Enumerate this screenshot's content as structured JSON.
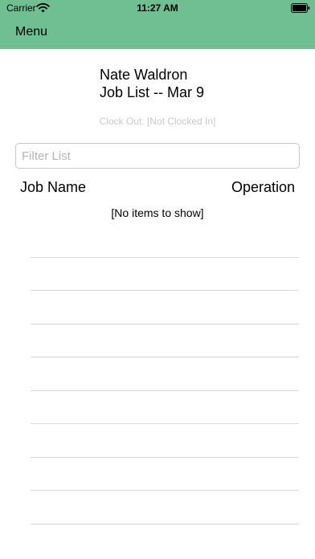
{
  "status_bar": {
    "carrier": "Carrier",
    "time": "11:27 AM",
    "icons": [
      "wifi-icon",
      "battery-icon"
    ]
  },
  "header": {
    "menu_label": "Menu",
    "background": "#6fbf93"
  },
  "title": {
    "name": "Nate Waldron",
    "subtitle": "Job List -- Mar 9"
  },
  "clock_status": "Clock Out: [Not Clocked In]",
  "filter": {
    "placeholder": "Filter List",
    "value": ""
  },
  "table": {
    "columns": [
      "Job Name",
      "Operation"
    ],
    "empty_message": "[No items to show]",
    "rows": []
  }
}
